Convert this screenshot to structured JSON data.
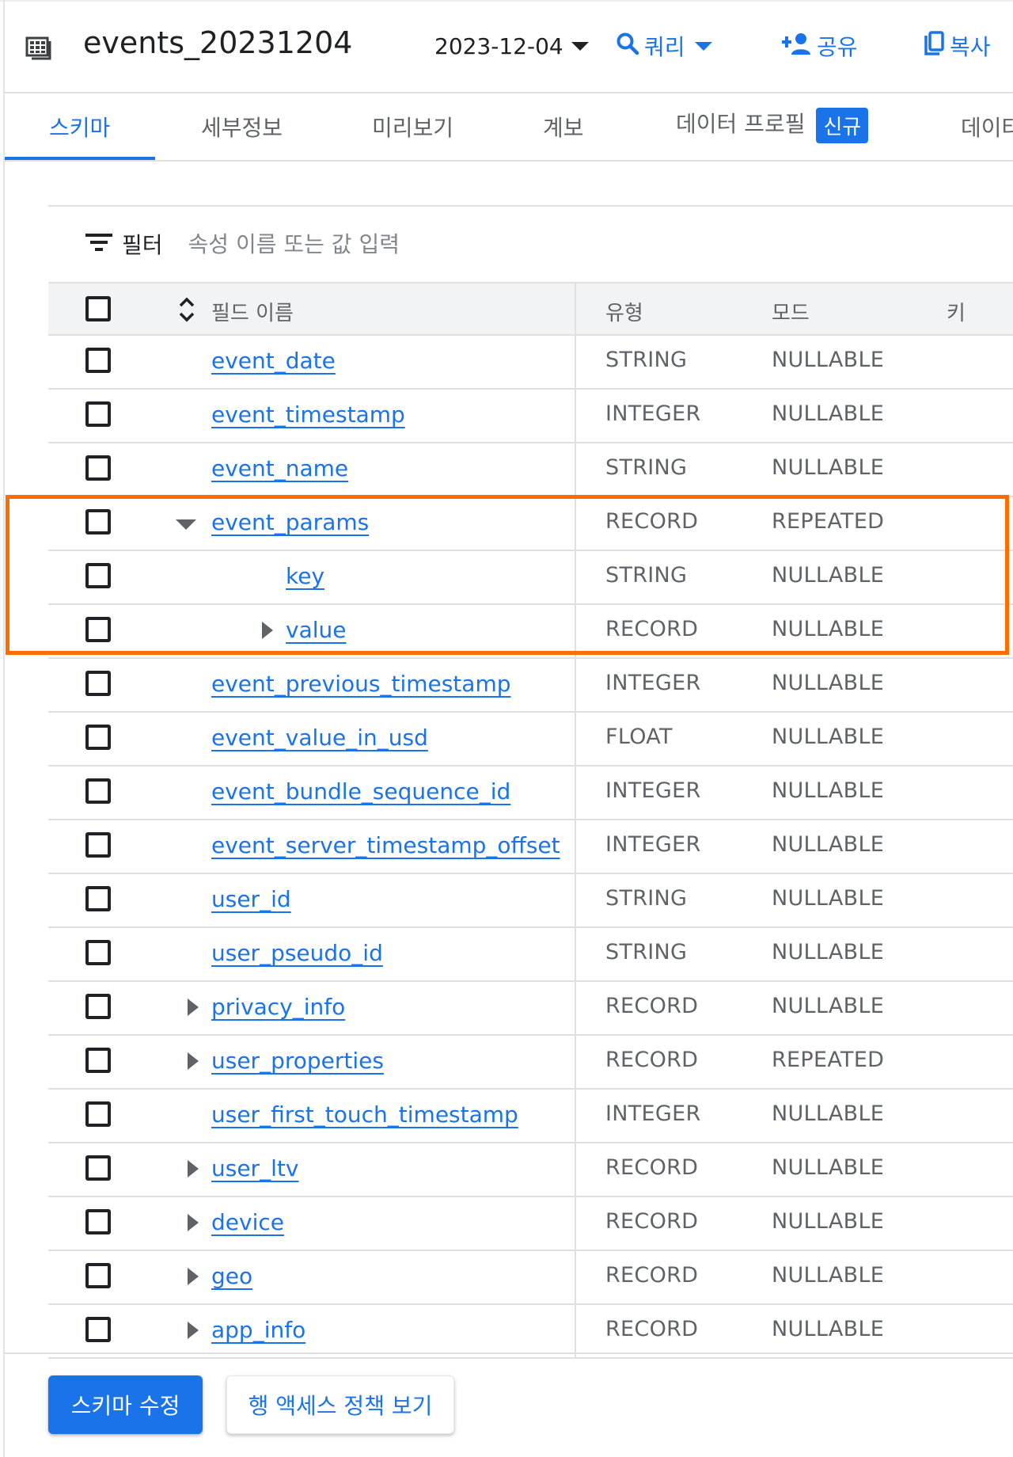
{
  "header": {
    "title": "events_20231204",
    "date": "2023-12-04",
    "query_label": "쿼리",
    "share_label": "공유",
    "copy_label": "복사"
  },
  "tabs": [
    {
      "label": "스키마",
      "active": true
    },
    {
      "label": "세부정보",
      "active": false
    },
    {
      "label": "미리보기",
      "active": false
    },
    {
      "label": "계보",
      "active": false
    },
    {
      "label": "데이터 프로필",
      "active": false,
      "badge": "신규"
    },
    {
      "label": "데이터",
      "active": false
    }
  ],
  "filter": {
    "label": "필터",
    "placeholder": "속성 이름 또는 값 입력"
  },
  "table": {
    "headers": {
      "field_name": "필드 이름",
      "type": "유형",
      "mode": "모드",
      "key": "키"
    },
    "rows": [
      {
        "name": "event_date",
        "type": "STRING",
        "mode": "NULLABLE",
        "level": 0,
        "expander": "none"
      },
      {
        "name": "event_timestamp",
        "type": "INTEGER",
        "mode": "NULLABLE",
        "level": 0,
        "expander": "none"
      },
      {
        "name": "event_name",
        "type": "STRING",
        "mode": "NULLABLE",
        "level": 0,
        "expander": "none"
      },
      {
        "name": "event_params",
        "type": "RECORD",
        "mode": "REPEATED",
        "level": 0,
        "expander": "expanded"
      },
      {
        "name": "key",
        "type": "STRING",
        "mode": "NULLABLE",
        "level": 1,
        "expander": "none"
      },
      {
        "name": "value",
        "type": "RECORD",
        "mode": "NULLABLE",
        "level": 1,
        "expander": "collapsed"
      },
      {
        "name": "event_previous_timestamp",
        "type": "INTEGER",
        "mode": "NULLABLE",
        "level": 0,
        "expander": "none"
      },
      {
        "name": "event_value_in_usd",
        "type": "FLOAT",
        "mode": "NULLABLE",
        "level": 0,
        "expander": "none"
      },
      {
        "name": "event_bundle_sequence_id",
        "type": "INTEGER",
        "mode": "NULLABLE",
        "level": 0,
        "expander": "none"
      },
      {
        "name": "event_server_timestamp_offset",
        "type": "INTEGER",
        "mode": "NULLABLE",
        "level": 0,
        "expander": "none"
      },
      {
        "name": "user_id",
        "type": "STRING",
        "mode": "NULLABLE",
        "level": 0,
        "expander": "none"
      },
      {
        "name": "user_pseudo_id",
        "type": "STRING",
        "mode": "NULLABLE",
        "level": 0,
        "expander": "none"
      },
      {
        "name": "privacy_info",
        "type": "RECORD",
        "mode": "NULLABLE",
        "level": 0,
        "expander": "collapsed"
      },
      {
        "name": "user_properties",
        "type": "RECORD",
        "mode": "REPEATED",
        "level": 0,
        "expander": "collapsed"
      },
      {
        "name": "user_first_touch_timestamp",
        "type": "INTEGER",
        "mode": "NULLABLE",
        "level": 0,
        "expander": "none"
      },
      {
        "name": "user_ltv",
        "type": "RECORD",
        "mode": "NULLABLE",
        "level": 0,
        "expander": "collapsed"
      },
      {
        "name": "device",
        "type": "RECORD",
        "mode": "NULLABLE",
        "level": 0,
        "expander": "collapsed"
      },
      {
        "name": "geo",
        "type": "RECORD",
        "mode": "NULLABLE",
        "level": 0,
        "expander": "collapsed"
      },
      {
        "name": "app_info",
        "type": "RECORD",
        "mode": "NULLABLE",
        "level": 0,
        "expander": "collapsed"
      }
    ]
  },
  "footer": {
    "edit_schema_label": "스키마 수정",
    "row_access_label": "행 액세스 정책 보기"
  },
  "colors": {
    "accent": "#1a73e8",
    "highlight": "#ff6d00"
  },
  "icons": [
    "table-icon",
    "chevron-down-icon",
    "search-icon",
    "person-add-icon",
    "copy-icon",
    "filter-icon",
    "sort-icon",
    "expand-icon",
    "collapse-icon"
  ]
}
